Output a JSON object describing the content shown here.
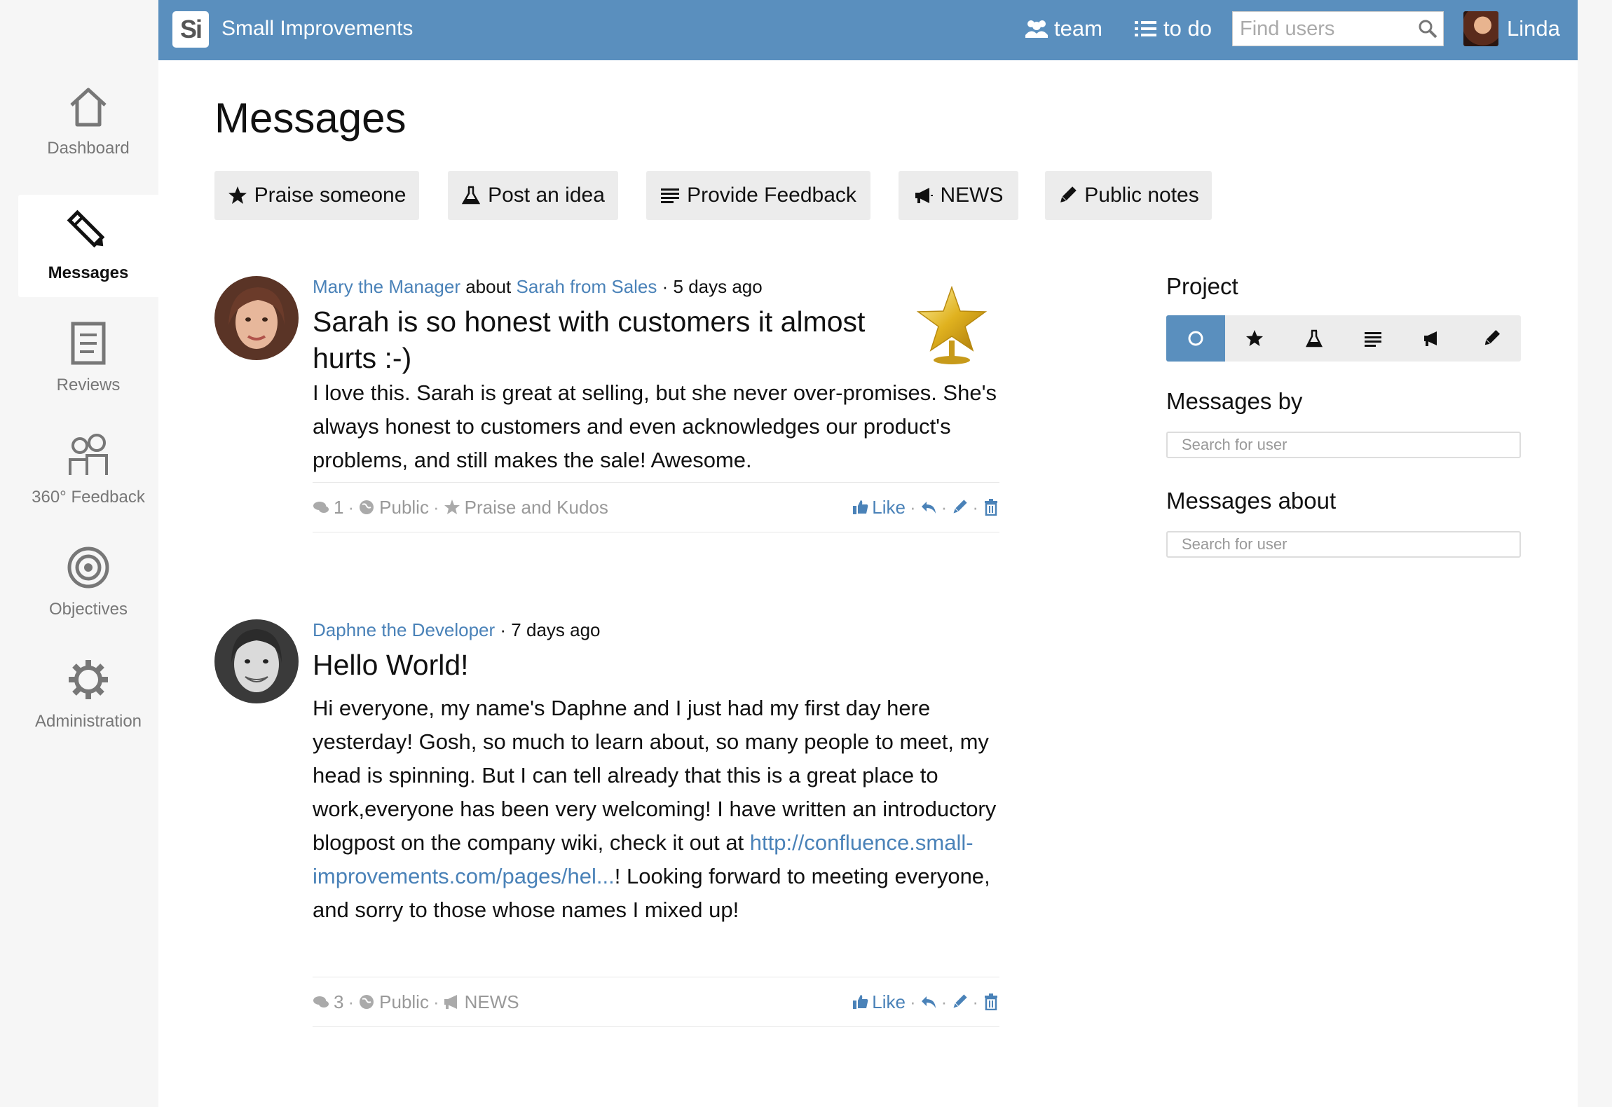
{
  "sidebar": {
    "items": [
      {
        "label": "Dashboard",
        "icon": "home-icon",
        "active": false
      },
      {
        "label": "Messages",
        "icon": "pencil-icon",
        "active": true
      },
      {
        "label": "Reviews",
        "icon": "document-icon",
        "active": false
      },
      {
        "label": "360° Feedback",
        "icon": "people-icon",
        "active": false
      },
      {
        "label": "Objectives",
        "icon": "target-icon",
        "active": false
      },
      {
        "label": "Administration",
        "icon": "gear-icon",
        "active": false
      }
    ]
  },
  "header": {
    "logo_text": "Si",
    "app_title": "Small Improvements",
    "team_label": "team",
    "todo_label": "to do",
    "search_placeholder": "Find users",
    "user_name": "Linda"
  },
  "page_title": "Messages",
  "actions": [
    {
      "label": "Praise someone",
      "icon": "star-icon"
    },
    {
      "label": "Post an idea",
      "icon": "flask-icon"
    },
    {
      "label": "Provide Feedback",
      "icon": "list-icon"
    },
    {
      "label": "NEWS",
      "icon": "megaphone-icon"
    },
    {
      "label": "Public notes",
      "icon": "pencil-icon"
    }
  ],
  "posts": [
    {
      "author": "Mary the Manager",
      "about_word": "about",
      "subject": "Sarah from Sales",
      "time": "· 5 days ago",
      "title": "Sarah is so honest with customers it almost hurts :-)",
      "text": "I love this. Sarah is great at selling, but she never over-promises. She's always honest to customers and even acknowledges our product's problems, and still makes the sale! Awesome.",
      "comments": "1",
      "visibility": "Public",
      "category": "Praise and Kudos",
      "like_label": "Like"
    },
    {
      "author": "Daphne the Developer",
      "time": "· 7 days ago",
      "title": "Hello World!",
      "text_before_link": "Hi everyone, my name's Daphne and I just had my first day here yesterday! Gosh, so much to learn about, so many people to meet, my head is spinning. But I can tell already that this is a great place to work,everyone has been very welcoming! I have written an introductory blogpost on the company wiki, check it out at ",
      "link_text": "http://confluence.small-improvements.com/pages/hel...",
      "text_after_link": "! Looking forward to meeting everyone, and sorry to those whose names I mixed up!",
      "comments": "3",
      "visibility": "Public",
      "category": "NEWS",
      "like_label": "Like"
    }
  ],
  "panel": {
    "project_title": "Project",
    "messages_by_title": "Messages by",
    "messages_by_placeholder": "Search for user",
    "messages_about_title": "Messages about",
    "messages_about_placeholder": "Search for user",
    "filters": [
      "circle-icon",
      "star-icon",
      "flask-icon",
      "list-icon",
      "megaphone-icon",
      "pencil-icon"
    ]
  },
  "colors": {
    "brand": "#5a8fbe",
    "link": "#4a82b8",
    "gold": "#e0b21f"
  }
}
